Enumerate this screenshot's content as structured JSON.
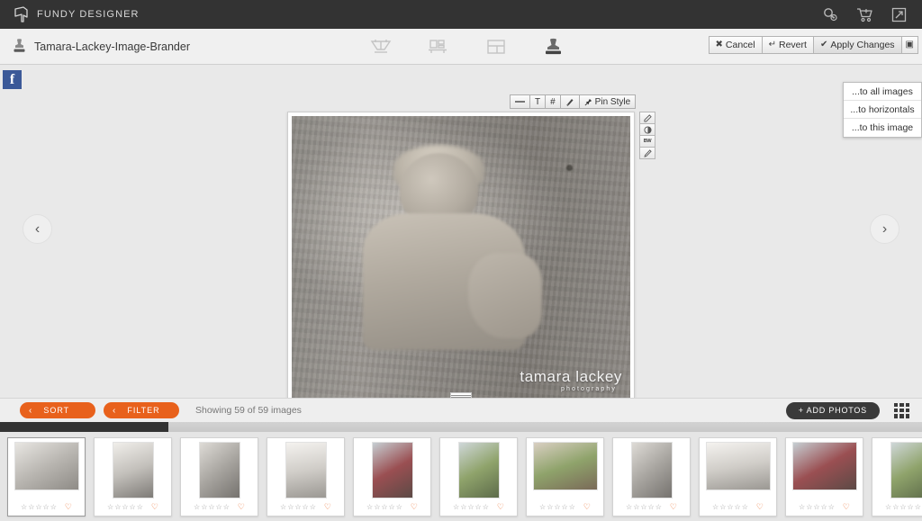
{
  "topbar": {
    "brand": "FUNDY DESIGNER",
    "logo_icon": "cube-logo-icon",
    "icons": [
      {
        "name": "search-settings-icon",
        "glyph": "search-gear-icon"
      },
      {
        "name": "add-to-cart-icon",
        "glyph": "cart-plus-icon"
      },
      {
        "name": "export-share-icon",
        "glyph": "external-link-icon"
      }
    ]
  },
  "toolbar": {
    "stamp_icon": "stamp-icon",
    "document_title": "Tamara-Lackey-Image-Brander",
    "tools": [
      {
        "name": "album-design-tool",
        "label": "album-icon",
        "active": false
      },
      {
        "name": "wall-art-tool",
        "label": "wall-art-icon",
        "active": false
      },
      {
        "name": "layout-tool",
        "label": "layout-grid-icon",
        "active": false
      },
      {
        "name": "image-brander-tool",
        "label": "stamp-icon",
        "active": true
      }
    ],
    "cancel_label": "Cancel",
    "cancel_glyph": "✖",
    "revert_label": "Revert",
    "revert_glyph": "↵",
    "apply_label": "Apply Changes",
    "apply_glyph": "✔",
    "options_glyph": "▣"
  },
  "dropdown": {
    "items": [
      {
        "label": "...to all images"
      },
      {
        "label": "...to horizontals"
      },
      {
        "label": "...to this image"
      }
    ]
  },
  "canvas": {
    "facebook_label": "f",
    "style_bar": [
      {
        "name": "line-style-button",
        "label": "",
        "glyph": "dash"
      },
      {
        "name": "text-style-button",
        "label": "T"
      },
      {
        "name": "grid-style-button",
        "label": "#"
      },
      {
        "name": "brush-style-button",
        "label": "✦"
      },
      {
        "name": "pin-style-button",
        "label": "Pin Style",
        "glyph": "✐"
      }
    ],
    "side_tools": [
      {
        "name": "edit-pencil-tool",
        "label": "✎"
      },
      {
        "name": "color-adjust-tool",
        "label": "◔"
      },
      {
        "name": "black-white-tool",
        "label": "BW"
      },
      {
        "name": "retouch-tool",
        "label": "✒"
      }
    ],
    "watermark_main": "tamara lackey",
    "watermark_sub": "photography",
    "prev_label": "‹",
    "next_label": "›"
  },
  "bottombar": {
    "sort_label": "SORT",
    "sort_chevron": "‹",
    "filter_label": "FILTER",
    "filter_chevron": "‹",
    "showing_text": "Showing 59 of 59 images",
    "add_photos_label": "+ ADD PHOTOS",
    "grid_view_icon": "grid-view-icon"
  },
  "colors": {
    "header_dark": "#333333",
    "accent_orange": "#e8611c",
    "facebook_blue": "#3b5998",
    "toolbar_light": "#f0f0f0",
    "canvas_bg": "#e9e9e9"
  },
  "thumbnails": {
    "star_glyph": "☆",
    "heart_glyph": "♡",
    "star_count": 5,
    "items": [
      {
        "orientation": "land",
        "tone": "bw",
        "selected": true
      },
      {
        "orientation": "port",
        "tone": "bw",
        "selected": false
      },
      {
        "orientation": "port",
        "tone": "bw",
        "selected": false
      },
      {
        "orientation": "port",
        "tone": "bw",
        "selected": false
      },
      {
        "orientation": "port",
        "tone": "color",
        "selected": false
      },
      {
        "orientation": "port",
        "tone": "color",
        "selected": false
      },
      {
        "orientation": "land",
        "tone": "color",
        "selected": false
      },
      {
        "orientation": "port",
        "tone": "bw",
        "selected": false
      },
      {
        "orientation": "land",
        "tone": "bw",
        "selected": false
      },
      {
        "orientation": "land",
        "tone": "color",
        "selected": false
      },
      {
        "orientation": "port",
        "tone": "color",
        "selected": false
      }
    ]
  }
}
